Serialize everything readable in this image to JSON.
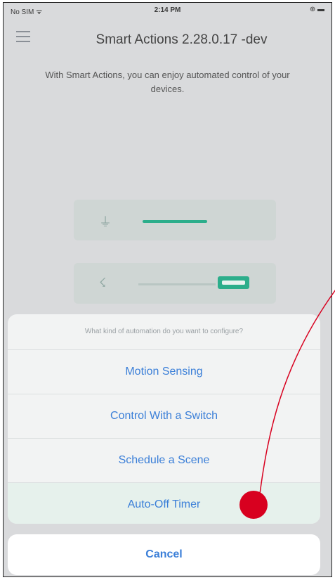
{
  "status_bar": {
    "carrier": "No SIM ᯤ",
    "time": "2:14 PM",
    "battery": "⊕ ▬"
  },
  "nav": {
    "title": "Smart Actions 2.28.0.17 -dev"
  },
  "intro": {
    "text": "With Smart Actions, you can enjoy automated control of your devices."
  },
  "sheet": {
    "title": "What kind of automation do you want to configure?",
    "options": [
      {
        "label": "Motion Sensing"
      },
      {
        "label": "Control With a Switch"
      },
      {
        "label": "Schedule a Scene"
      },
      {
        "label": "Auto-Off Timer"
      }
    ],
    "cancel_label": "Cancel"
  },
  "colors": {
    "accent_blue": "#3b7fd8",
    "accent_green": "#2cae8b",
    "annotation_red": "#d8001f"
  }
}
